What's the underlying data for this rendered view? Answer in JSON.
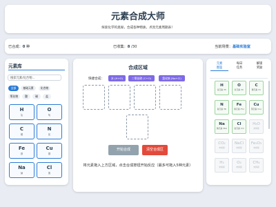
{
  "header": {
    "title": "元素合成大师",
    "subtitle": "探索化学的奥秘，合成各种物质，点亮元素周期表！"
  },
  "stats": {
    "collected_label": "已合成：",
    "collected_value": "0",
    "collected_unit": "种",
    "collection_label": "已收集：",
    "collection_value": "8",
    "collection_total": "/30",
    "scene_label": "当前场景：",
    "scene_value": "基础实验室"
  },
  "library": {
    "title": "元素库",
    "search_placeholder": "搜索元素/化合物...",
    "filters": [
      "全部",
      "基础元素",
      "化合物",
      "氧化物",
      "酸",
      "碱",
      "盐"
    ],
    "elements": [
      {
        "symbol": "H",
        "name": "氢"
      },
      {
        "symbol": "O",
        "name": "氧"
      },
      {
        "symbol": "C",
        "name": "碳"
      },
      {
        "symbol": "N",
        "name": "氮"
      },
      {
        "symbol": "Fe",
        "name": "铁"
      },
      {
        "symbol": "Cu",
        "name": "铜"
      },
      {
        "symbol": "Na",
        "name": "钠"
      },
      {
        "symbol": "Cl",
        "name": "氯"
      }
    ]
  },
  "synthesis": {
    "title": "合成区域",
    "quick_label": "快捷合成：",
    "quick_buttons": [
      "水 (H+O)",
      "二氧化碳 (C+O)",
      "氯化钠 (Na+Cl)"
    ],
    "start_button": "开始合成",
    "clear_button": "清空合成区",
    "hint": "将元素拖入上方区域，点击合成按钮开始反应（最多可拖入5种元素）"
  },
  "sidebar": {
    "tabs": [
      "元素图鉴",
      "每日任务",
      "解锁奖励"
    ],
    "cells": [
      {
        "symbol": "H",
        "name": "氢元素 (H)",
        "locked": false
      },
      {
        "symbol": "O",
        "name": "氧元素 (O)",
        "locked": false
      },
      {
        "symbol": "C",
        "name": "碳元素 (C)",
        "locked": false
      },
      {
        "symbol": "N",
        "name": "氮元素 (N)",
        "locked": false
      },
      {
        "symbol": "Fe",
        "name": "铁元素 (Fe)",
        "locked": false
      },
      {
        "symbol": "Cu",
        "name": "铜元素 (Cu)",
        "locked": false
      },
      {
        "symbol": "Na",
        "name": "钠元素 (Na)",
        "locked": false
      },
      {
        "symbol": "Cl",
        "name": "氯元素 (Cl)",
        "locked": false
      },
      {
        "symbol": "H₂O",
        "name": "未解锁",
        "locked": true
      },
      {
        "symbol": "CO₂",
        "name": "未解锁",
        "locked": true
      },
      {
        "symbol": "NaCl",
        "name": "未解锁",
        "locked": true
      },
      {
        "symbol": "Fe₂O₃",
        "name": "未解锁",
        "locked": true
      },
      {
        "symbol": "H₂",
        "name": "未解锁",
        "locked": true
      },
      {
        "symbol": "O₂",
        "name": "未解锁",
        "locked": true
      },
      {
        "symbol": "CH₄",
        "name": "未解锁",
        "locked": true
      }
    ]
  },
  "colors": {
    "accent": "#2a7bd5",
    "quick": "#7e6ae6",
    "start": "#93a3ad",
    "clear": "#e24a3b",
    "unlocked_border": "#9dd39f"
  }
}
